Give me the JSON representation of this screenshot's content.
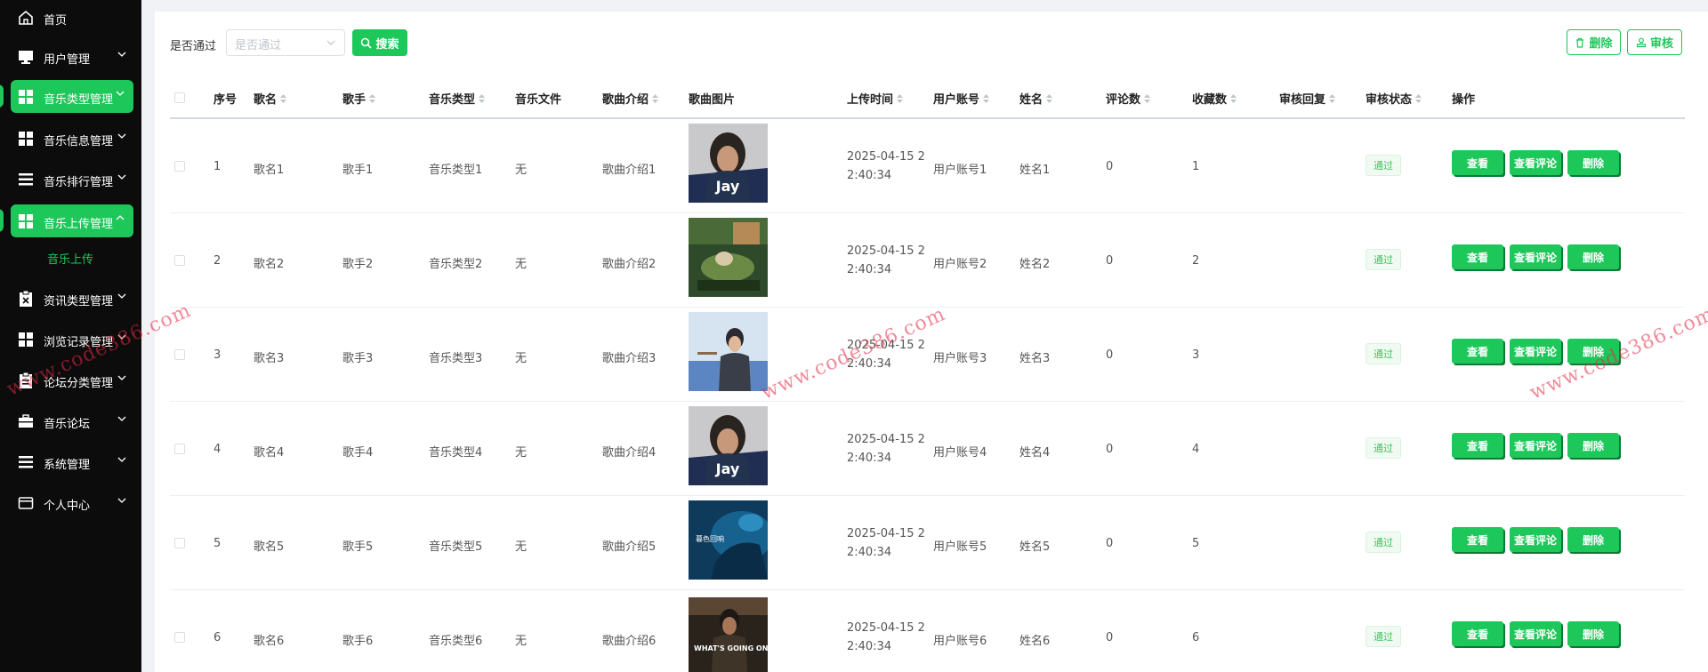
{
  "sidebar": {
    "items": [
      {
        "label": "首页",
        "icon": "home-icon"
      },
      {
        "label": "用户管理",
        "icon": "monitor-icon"
      },
      {
        "label": "音乐类型管理",
        "icon": "grid-icon"
      },
      {
        "label": "音乐信息管理",
        "icon": "grid-icon"
      },
      {
        "label": "音乐排行管理",
        "icon": "list-icon"
      },
      {
        "label": "音乐上传管理",
        "icon": "grid-icon"
      },
      {
        "label": "资讯类型管理",
        "icon": "clipboard-icon"
      },
      {
        "label": "浏览记录管理",
        "icon": "grid-icon"
      },
      {
        "label": "论坛分类管理",
        "icon": "clipboard-icon"
      },
      {
        "label": "音乐论坛",
        "icon": "briefcase-icon"
      },
      {
        "label": "系统管理",
        "icon": "list-icon"
      },
      {
        "label": "个人中心",
        "icon": "wallet-icon"
      }
    ],
    "sub_item": "音乐上传"
  },
  "filter": {
    "label": "是否通过",
    "placeholder": "是否通过",
    "search_label": "搜索"
  },
  "toolbar": {
    "delete_label": "删除",
    "review_label": "审核"
  },
  "table": {
    "headers": [
      "序号",
      "歌名",
      "歌手",
      "音乐类型",
      "音乐文件",
      "歌曲介绍",
      "歌曲图片",
      "上传时间",
      "用户账号",
      "姓名",
      "评论数",
      "收藏数",
      "审核回复",
      "审核状态",
      "操作"
    ],
    "rows": [
      {
        "idx": "1",
        "song": "歌名1",
        "singer": "歌手1",
        "type": "音乐类型1",
        "file": "无",
        "intro": "歌曲介绍1",
        "time": "2025-04-15 22:40:34",
        "account": "用户账号1",
        "name": "姓名1",
        "comments": "0",
        "favs": "1",
        "reply": "",
        "status": "通过"
      },
      {
        "idx": "2",
        "song": "歌名2",
        "singer": "歌手2",
        "type": "音乐类型2",
        "file": "无",
        "intro": "歌曲介绍2",
        "time": "2025-04-15 22:40:34",
        "account": "用户账号2",
        "name": "姓名2",
        "comments": "0",
        "favs": "2",
        "reply": "",
        "status": "通过"
      },
      {
        "idx": "3",
        "song": "歌名3",
        "singer": "歌手3",
        "type": "音乐类型3",
        "file": "无",
        "intro": "歌曲介绍3",
        "time": "2025-04-15 22:40:34",
        "account": "用户账号3",
        "name": "姓名3",
        "comments": "0",
        "favs": "3",
        "reply": "",
        "status": "通过"
      },
      {
        "idx": "4",
        "song": "歌名4",
        "singer": "歌手4",
        "type": "音乐类型4",
        "file": "无",
        "intro": "歌曲介绍4",
        "time": "2025-04-15 22:40:34",
        "account": "用户账号4",
        "name": "姓名4",
        "comments": "0",
        "favs": "4",
        "reply": "",
        "status": "通过"
      },
      {
        "idx": "5",
        "song": "歌名5",
        "singer": "歌手5",
        "type": "音乐类型5",
        "file": "无",
        "intro": "歌曲介绍5",
        "time": "2025-04-15 22:40:34",
        "account": "用户账号5",
        "name": "姓名5",
        "comments": "0",
        "favs": "5",
        "reply": "",
        "status": "通过"
      },
      {
        "idx": "6",
        "song": "歌名6",
        "singer": "歌手6",
        "type": "音乐类型6",
        "file": "无",
        "intro": "歌曲介绍6",
        "time": "2025-04-15 22:40:34",
        "account": "用户账号6",
        "name": "姓名6",
        "comments": "0",
        "favs": "6",
        "reply": "",
        "status": "通过"
      }
    ],
    "thumb_texts": [
      "Jay",
      "",
      "",
      "Jay",
      "暮色回响",
      "WHAT'S GOING ON...?"
    ],
    "actions": {
      "view": "查看",
      "view_comments": "查看评论",
      "delete": "删除"
    }
  },
  "watermark": "www.code386.com",
  "colors": {
    "accent": "#1ec75a",
    "sidebar_bg": "#0c0c0c",
    "badge_text": "#45c05f"
  }
}
